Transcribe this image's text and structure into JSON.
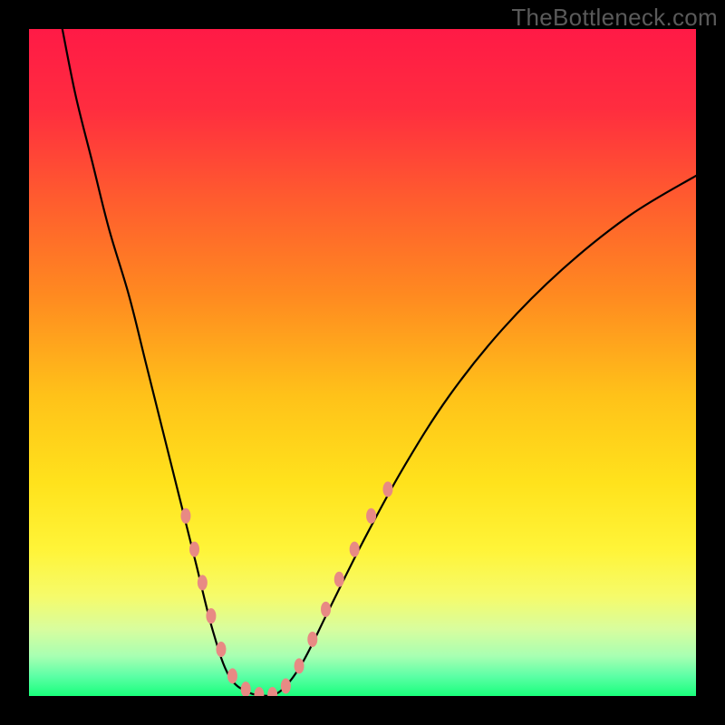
{
  "watermark_text": "TheBottleneck.com",
  "chart_data": {
    "type": "line",
    "title": "",
    "xlabel": "",
    "ylabel": "",
    "xlim": [
      0,
      100
    ],
    "ylim": [
      0,
      100
    ],
    "background_gradient_stops": [
      {
        "offset": 0.0,
        "color": "#ff1a46"
      },
      {
        "offset": 0.12,
        "color": "#ff2d3f"
      },
      {
        "offset": 0.25,
        "color": "#ff5a2f"
      },
      {
        "offset": 0.4,
        "color": "#ff8a20"
      },
      {
        "offset": 0.55,
        "color": "#ffc219"
      },
      {
        "offset": 0.68,
        "color": "#ffe21c"
      },
      {
        "offset": 0.78,
        "color": "#fff438"
      },
      {
        "offset": 0.85,
        "color": "#f6fb6a"
      },
      {
        "offset": 0.9,
        "color": "#d8fd9e"
      },
      {
        "offset": 0.94,
        "color": "#a8ffb2"
      },
      {
        "offset": 0.97,
        "color": "#5dffa6"
      },
      {
        "offset": 1.0,
        "color": "#19ff7b"
      }
    ],
    "series": [
      {
        "name": "left-curve",
        "stroke": "#000000",
        "stroke_width": 2.2,
        "points": [
          {
            "x": 5.0,
            "y": 100.0
          },
          {
            "x": 7.0,
            "y": 90.0
          },
          {
            "x": 9.5,
            "y": 80.0
          },
          {
            "x": 12.0,
            "y": 70.0
          },
          {
            "x": 15.0,
            "y": 60.0
          },
          {
            "x": 17.5,
            "y": 50.0
          },
          {
            "x": 20.0,
            "y": 40.0
          },
          {
            "x": 22.5,
            "y": 30.0
          },
          {
            "x": 25.0,
            "y": 20.0
          },
          {
            "x": 27.5,
            "y": 10.0
          },
          {
            "x": 30.0,
            "y": 3.0
          },
          {
            "x": 33.0,
            "y": 0.5
          },
          {
            "x": 36.0,
            "y": 0.0
          }
        ]
      },
      {
        "name": "right-curve",
        "stroke": "#000000",
        "stroke_width": 2.2,
        "points": [
          {
            "x": 36.0,
            "y": 0.0
          },
          {
            "x": 38.0,
            "y": 1.0
          },
          {
            "x": 41.0,
            "y": 5.0
          },
          {
            "x": 45.0,
            "y": 13.0
          },
          {
            "x": 50.0,
            "y": 23.0
          },
          {
            "x": 56.0,
            "y": 34.0
          },
          {
            "x": 63.0,
            "y": 45.0
          },
          {
            "x": 71.0,
            "y": 55.0
          },
          {
            "x": 80.0,
            "y": 64.0
          },
          {
            "x": 90.0,
            "y": 72.0
          },
          {
            "x": 100.0,
            "y": 78.0
          }
        ]
      }
    ],
    "markers": {
      "color": "#e88a84",
      "rx": 5.5,
      "ry": 8.5,
      "points": [
        {
          "x": 23.5,
          "y": 27.0
        },
        {
          "x": 24.8,
          "y": 22.0
        },
        {
          "x": 26.0,
          "y": 17.0
        },
        {
          "x": 27.3,
          "y": 12.0
        },
        {
          "x": 28.8,
          "y": 7.0
        },
        {
          "x": 30.5,
          "y": 3.0
        },
        {
          "x": 32.5,
          "y": 1.0
        },
        {
          "x": 34.5,
          "y": 0.2
        },
        {
          "x": 36.5,
          "y": 0.2
        },
        {
          "x": 38.5,
          "y": 1.5
        },
        {
          "x": 40.5,
          "y": 4.5
        },
        {
          "x": 42.5,
          "y": 8.5
        },
        {
          "x": 44.5,
          "y": 13.0
        },
        {
          "x": 46.5,
          "y": 17.5
        },
        {
          "x": 48.8,
          "y": 22.0
        },
        {
          "x": 51.3,
          "y": 27.0
        },
        {
          "x": 53.8,
          "y": 31.0
        }
      ]
    }
  }
}
